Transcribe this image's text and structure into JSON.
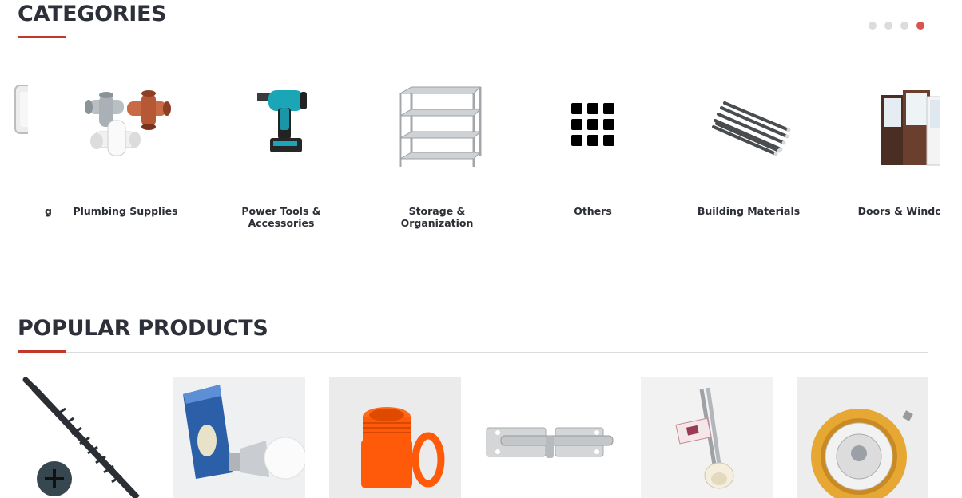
{
  "categories_section": {
    "title": "CATEGORIES",
    "carousel_pages": 4,
    "active_page": 4,
    "items": [
      {
        "label": "g",
        "icon": "partial-product-icon"
      },
      {
        "label": "Plumbing Supplies",
        "icon": "pipe-fittings-icon"
      },
      {
        "label": "Power Tools &\nAccessories",
        "icon": "cordless-drill-icon"
      },
      {
        "label": "Storage &\nOrganization",
        "icon": "shelving-rack-icon"
      },
      {
        "label": "Others",
        "icon": "grid-icon"
      },
      {
        "label": "Building Materials",
        "icon": "rebar-bundle-icon"
      },
      {
        "label": "Doors & Window",
        "icon": "doors-windows-icon"
      }
    ]
  },
  "popular_section": {
    "title": "POPULAR PRODUCTS",
    "products": [
      {
        "icon": "drywall-screw-icon"
      },
      {
        "icon": "led-bulb-icon"
      },
      {
        "icon": "pipe-adapter-icon"
      },
      {
        "icon": "barrel-bolt-icon"
      },
      {
        "icon": "heating-element-icon"
      },
      {
        "icon": "ceiling-downlight-icon"
      }
    ]
  },
  "colors": {
    "accent": "#c0392b",
    "active_dot": "#d9534f",
    "heading": "#2d3038"
  }
}
